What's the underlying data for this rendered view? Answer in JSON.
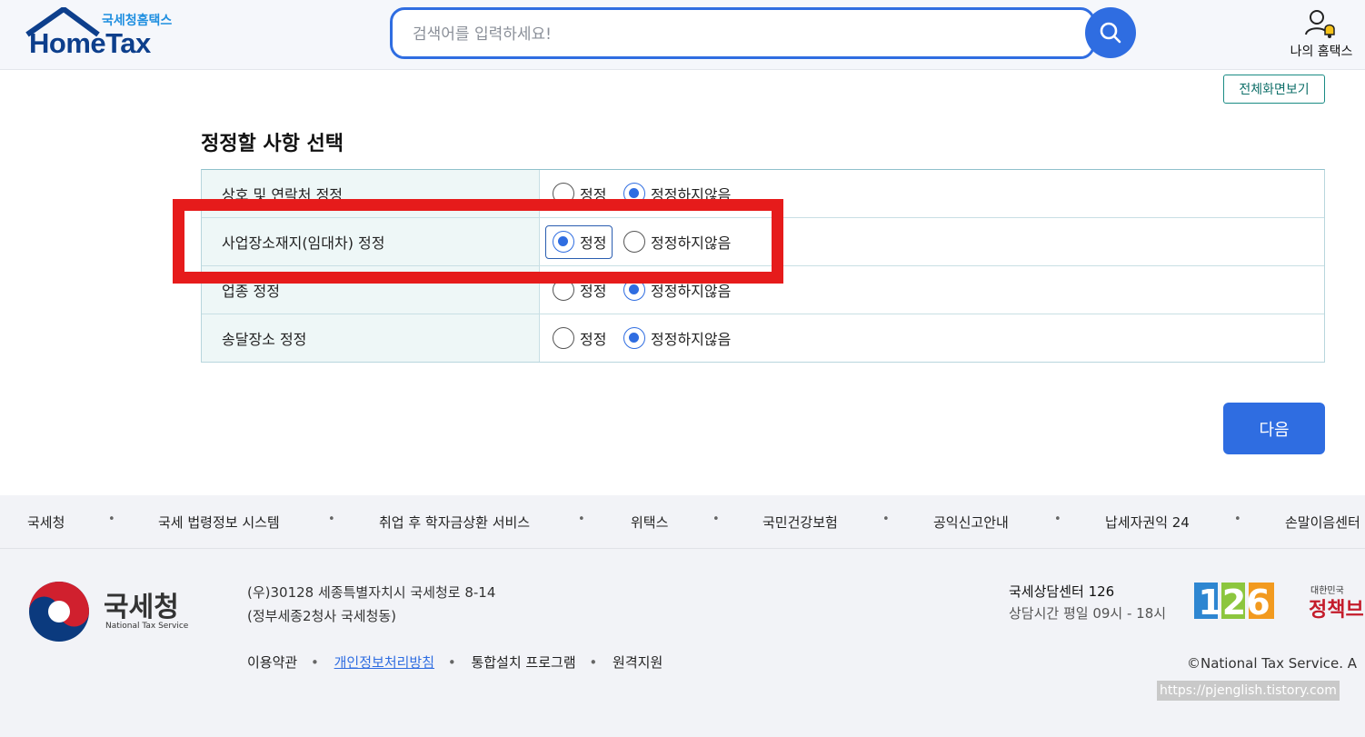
{
  "header": {
    "logo_sub": "국세청홈택스",
    "logo_main": "HomeTax",
    "search_placeholder": "검색어를 입력하세요!",
    "my_hometax": "나의 홈택스"
  },
  "main": {
    "full_screen_label": "전체화면보기",
    "section_title": "정정할 사항 선택",
    "rows": [
      {
        "label": "상호 및 연락처 정정",
        "opt1": "정정",
        "opt2": "정정하지않음",
        "selected": "opt2"
      },
      {
        "label": "사업장소재지(임대차) 정정",
        "opt1": "정정",
        "opt2": "정정하지않음",
        "selected": "opt1"
      },
      {
        "label": "업종 정정",
        "opt1": "정정",
        "opt2": "정정하지않음",
        "selected": "opt2"
      },
      {
        "label": "송달장소 정정",
        "opt1": "정정",
        "opt2": "정정하지않음",
        "selected": "opt2"
      }
    ],
    "next_label": "다음"
  },
  "footer": {
    "links": [
      "국세청",
      "국세 법령정보 시스템",
      "취업 후 학자금상환 서비스",
      "위택스",
      "국민건강보험",
      "공익신고안내",
      "납세자권익 24",
      "손말이음센터"
    ],
    "nts_name": "국세청",
    "nts_eng": "National Tax Service",
    "address1": "(우)30128 세종특별자치시 국세청로 8-14",
    "address2": "(정부세종2청사 국세청동)",
    "policy": [
      "이용약관",
      "개인정보처리방침",
      "통합설치 프로그램",
      "원격지원"
    ],
    "center_title": "국세상담센터 126",
    "center_hours": "상담시간 평일 09시 - 18시",
    "logo126": "126",
    "gov_small": "대한민국",
    "gov_big": "정책브",
    "copyright": "©National Tax Service. A",
    "watermark": "https://pjenglish.tistory.com"
  },
  "colors": {
    "primary": "#2f6de1",
    "highlight": "#e61b1b",
    "table_label_bg": "#eef7f7",
    "brand_navy": "#0d3f8c"
  }
}
